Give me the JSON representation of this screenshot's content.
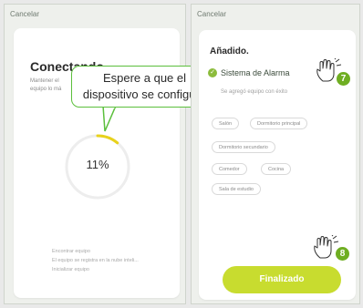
{
  "left": {
    "cancel": "Cancelar",
    "title": "Conectando",
    "description_line1": "Mantener el",
    "description_line2": "equipo lo má",
    "progress_percent": 11,
    "progress_label": "11%",
    "steps": [
      "Encontrar equipo",
      "El equipo se registra en la nube inteli...",
      "Inicializar equipo"
    ]
  },
  "callout": {
    "line1": "Espere a que el",
    "line2": "dispositivo se configure"
  },
  "right": {
    "cancel": "Cancelar",
    "title": "Añadido.",
    "device_name": "Sistema de Alarma",
    "device_sub": "Se agregó equipo con éxito",
    "rooms": [
      "Salón",
      "Dormitorio principal",
      "Dormitorio secundario",
      "Comedor",
      "Cocina",
      "Sala de estudio"
    ],
    "finish_label": "Finalizado"
  },
  "badges": {
    "step7": "7",
    "step8": "8"
  },
  "colors": {
    "accent_green": "#5bbf3c",
    "button_lime": "#c8dc2f",
    "progress_yellow": "#e8d21c",
    "badge_green": "#6fae22"
  }
}
